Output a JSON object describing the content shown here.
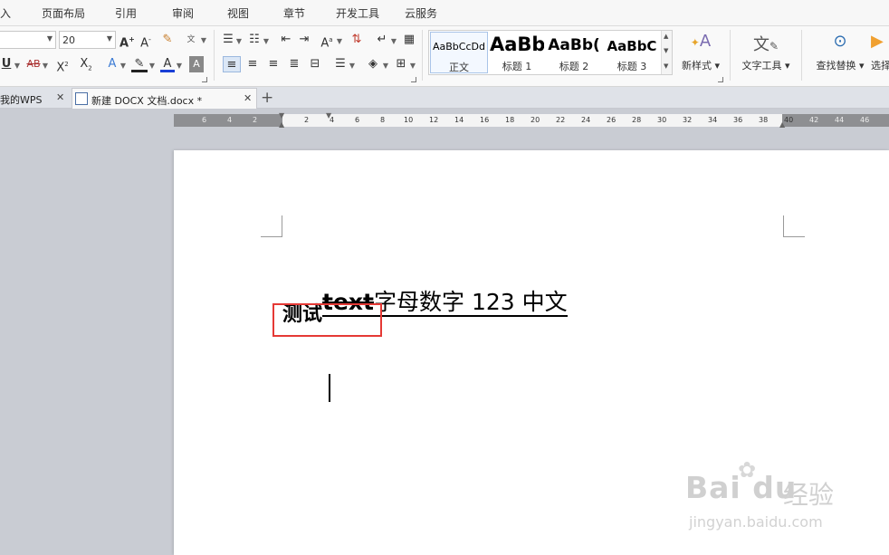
{
  "menu": [
    "入",
    "页面布局",
    "引用",
    "审阅",
    "视图",
    "章节",
    "开发工具",
    "云服务"
  ],
  "ribbon": {
    "font_size": "20",
    "styles": [
      {
        "sample": "AaBbCcDd",
        "name": "正文"
      },
      {
        "sample": "AaBb",
        "name": "标题 1"
      },
      {
        "sample": "AaBb(",
        "name": "标题 2"
      },
      {
        "sample": "AaBbC",
        "name": "标题 3"
      }
    ],
    "new_style_label": "新样式",
    "text_tools_label": "文字工具",
    "find_replace_label": "查找替换",
    "select_label": "选择"
  },
  "tabs": [
    {
      "label": "我的WPS",
      "active": false
    },
    {
      "label": "新建 DOCX 文档.docx *",
      "active": true
    }
  ],
  "ruler": {
    "numbers": [
      "6",
      "4",
      "2",
      "2",
      "4",
      "6",
      "8",
      "10",
      "12",
      "14",
      "16",
      "18",
      "20",
      "22",
      "24",
      "26",
      "28",
      "30",
      "32",
      "34",
      "36",
      "38",
      "40",
      "42",
      "44",
      "46"
    ]
  },
  "document": {
    "segment_a": "测试",
    "segment_b": "text",
    "segment_c": "字母数字 123 中文"
  },
  "watermark": {
    "logo": "Bai du",
    "logo_cn": "经验",
    "url": "jingyan.baidu.com"
  },
  "colors": {
    "highlight_border": "#e53935",
    "active_format_button": "#dbe7f6"
  }
}
